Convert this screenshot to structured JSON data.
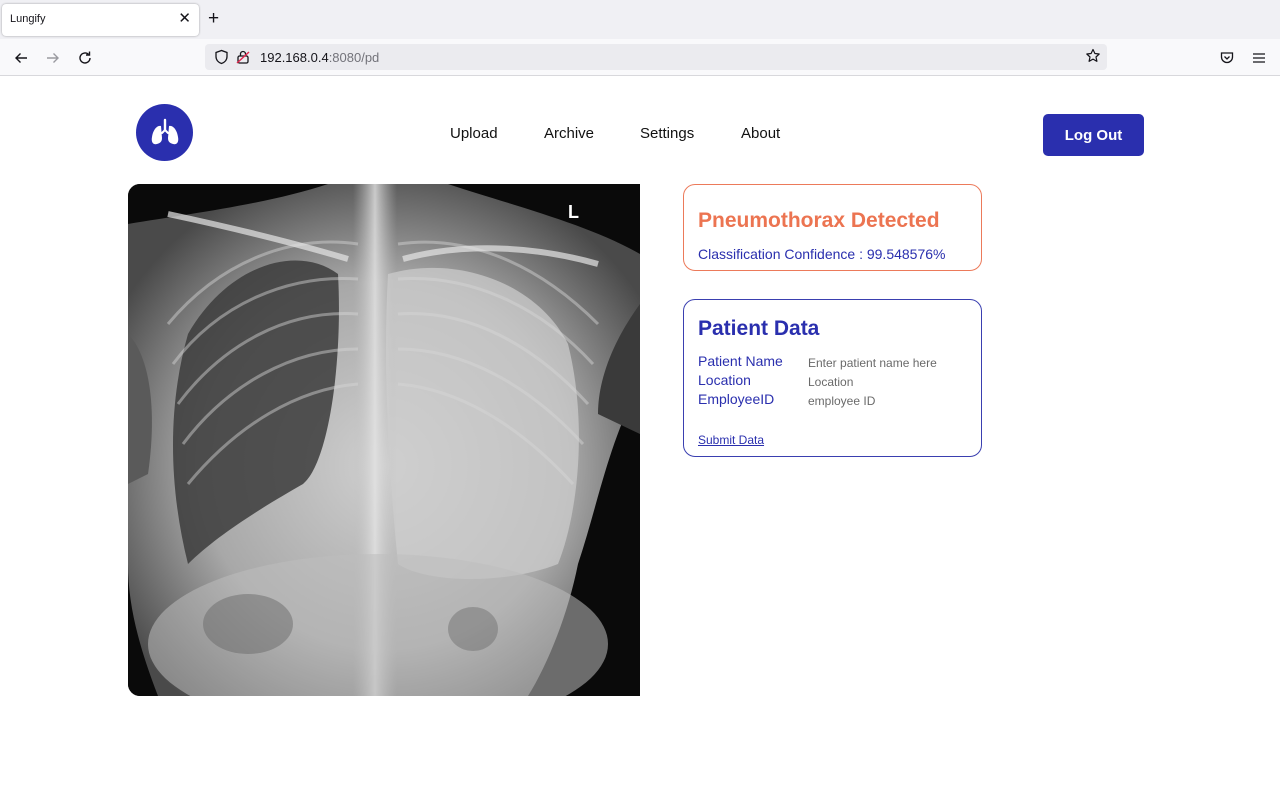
{
  "browser": {
    "tab_title": "Lungify",
    "tab_close": "✕",
    "new_tab": "+",
    "url_host": "192.168.0.4",
    "url_rest": ":8080/pd"
  },
  "nav": {
    "links": [
      "Upload",
      "Archive",
      "Settings",
      "About"
    ],
    "logout_label": "Log Out"
  },
  "xray": {
    "marker": "L"
  },
  "result": {
    "title": "Pneumothorax Detected",
    "confidence": "Classification Confidence : 99.548576%"
  },
  "patient": {
    "title": "Patient Data",
    "fields": [
      {
        "label": "Patient Name",
        "placeholder": "Enter patient name here"
      },
      {
        "label": "Location",
        "placeholder": "Location"
      },
      {
        "label": "EmployeeID",
        "placeholder": "employee ID"
      }
    ],
    "submit_label": "Submit Data"
  },
  "colors": {
    "brand": "#2a2fae",
    "alert": "#ec7451"
  }
}
